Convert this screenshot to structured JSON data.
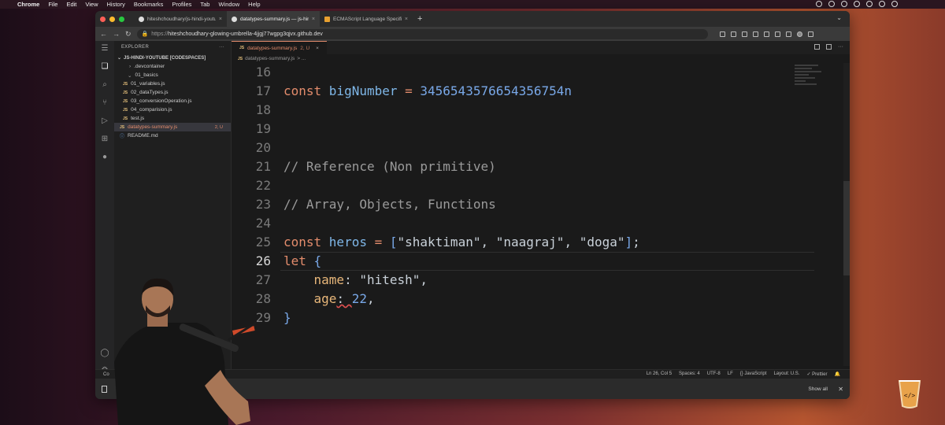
{
  "menubar": {
    "app": "Chrome",
    "items": [
      "File",
      "Edit",
      "View",
      "History",
      "Bookmarks",
      "Profiles",
      "Tab",
      "Window",
      "Help"
    ]
  },
  "browser": {
    "tabs": [
      {
        "title": "hiteshchoudhary/js-hindi-youtube",
        "active": false
      },
      {
        "title": "datatypes-summary.js — js-hindi",
        "active": true
      },
      {
        "title": "ECMAScript Language Specification",
        "active": false
      }
    ],
    "url_protocol": "https://",
    "url": "hiteshchoudhary-glowing-umbrella-4jjgj77wgpg3qjvx.github.dev"
  },
  "explorer": {
    "title": "EXPLORER",
    "root": "JS-HINDI-YOUTUBE [CODESPACES]",
    "items": [
      {
        "label": ".devcontainer",
        "type": "folder",
        "indent": 0
      },
      {
        "label": "01_basics",
        "type": "folder-open",
        "indent": 0
      },
      {
        "label": "01_variables.js",
        "type": "js",
        "indent": 1
      },
      {
        "label": "02_dataTypes.js",
        "type": "js",
        "indent": 1
      },
      {
        "label": "03_conversionOperation.js",
        "type": "js",
        "indent": 1
      },
      {
        "label": "04_comparision.js",
        "type": "js",
        "indent": 1
      },
      {
        "label": "test.js",
        "type": "js",
        "indent": 1
      },
      {
        "label": "datatypes-summary.js",
        "type": "js",
        "indent": 0,
        "selected": true,
        "flag": "2, U"
      },
      {
        "label": "README.md",
        "type": "md",
        "indent": 0
      }
    ]
  },
  "editor": {
    "tab_label": "datatypes-summary.js",
    "tab_meta": "2, U",
    "breadcrumb_file": "datatypes-summary.js",
    "breadcrumb_rest": "> ...",
    "lines": [
      {
        "n": "16",
        "tokens": []
      },
      {
        "n": "17",
        "tokens": [
          [
            "kw",
            "const "
          ],
          [
            "var",
            "bigNumber "
          ],
          [
            "op",
            "= "
          ],
          [
            "num",
            "3456543576654356754n"
          ]
        ]
      },
      {
        "n": "18",
        "tokens": []
      },
      {
        "n": "19",
        "tokens": []
      },
      {
        "n": "20",
        "tokens": []
      },
      {
        "n": "21",
        "tokens": [
          [
            "cm",
            "// Reference (Non primitive)"
          ]
        ]
      },
      {
        "n": "22",
        "tokens": []
      },
      {
        "n": "23",
        "tokens": [
          [
            "cm",
            "// Array, Objects, Functions"
          ]
        ]
      },
      {
        "n": "24",
        "tokens": []
      },
      {
        "n": "25",
        "tokens": [
          [
            "kw",
            "const "
          ],
          [
            "var",
            "heros "
          ],
          [
            "op",
            "= "
          ],
          [
            "brk",
            "["
          ],
          [
            "str",
            "\"shaktiman\""
          ],
          [
            "punc",
            ", "
          ],
          [
            "str",
            "\"naagraj\""
          ],
          [
            "punc",
            ", "
          ],
          [
            "str",
            "\"doga\""
          ],
          [
            "brk",
            "]"
          ],
          [
            "punc",
            ";"
          ]
        ]
      },
      {
        "n": "26",
        "tokens": [
          [
            "kw",
            "let "
          ],
          [
            "brk",
            "{"
          ]
        ],
        "current": true
      },
      {
        "n": "27",
        "tokens": [
          [
            "punc",
            "    "
          ],
          [
            "prop",
            "name"
          ],
          [
            "punc",
            ": "
          ],
          [
            "str",
            "\"hitesh\""
          ],
          [
            "punc",
            ","
          ]
        ]
      },
      {
        "n": "28",
        "tokens": [
          [
            "punc",
            "    "
          ],
          [
            "prop",
            "age"
          ],
          [
            "punc",
            ": "
          ],
          [
            "num",
            "22"
          ],
          [
            "punc",
            ","
          ]
        ]
      },
      {
        "n": "29",
        "tokens": [
          [
            "brk",
            "}"
          ]
        ]
      }
    ]
  },
  "statusbar": {
    "left": [
      "Co",
      "0"
    ],
    "right": [
      "Ln 26, Col 5",
      "Spaces: 4",
      "UTF-8",
      "LF",
      "{} JavaScript",
      "Layout: U.S.",
      "✓ Prettier"
    ]
  },
  "download_bar": {
    "show_all": "Show all"
  },
  "icons": {
    "explorer": "files-icon",
    "search": "search-icon",
    "source-control": "source-control-icon",
    "run": "run-debug-icon",
    "extensions": "extensions-icon",
    "github": "github-icon",
    "account": "account-icon",
    "settings": "gear-icon"
  }
}
